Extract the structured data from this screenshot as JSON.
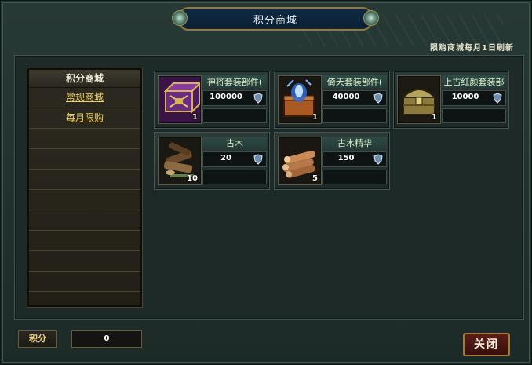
{
  "window": {
    "title": "积分商城",
    "refresh_note": "限购商城每月1日刷新"
  },
  "sidebar": {
    "heading": "积分商城",
    "items": [
      {
        "label": "常规商城"
      },
      {
        "label": "每月限购"
      }
    ]
  },
  "items": [
    {
      "name": "神将套装部件(",
      "price": "100000",
      "qty": "1",
      "icon": "purple-chest-icon"
    },
    {
      "name": "倚天套装部件(",
      "price": "40000",
      "qty": "1",
      "icon": "blue-flame-box-icon"
    },
    {
      "name": "上古红颜套装部",
      "price": "10000",
      "qty": "1",
      "icon": "golden-chest-icon"
    },
    {
      "name": "古木",
      "price": "20",
      "qty": "10",
      "icon": "ancient-wood-icon"
    },
    {
      "name": "古木精华",
      "price": "150",
      "qty": "5",
      "icon": "wood-essence-icon"
    }
  ],
  "footer": {
    "points_label": "积分",
    "points_value": "0",
    "close_label": "关闭"
  },
  "colors": {
    "accent_gold": "#f1d76a",
    "close_red": "#5a1d16",
    "title_blue": "#0f2a44"
  }
}
